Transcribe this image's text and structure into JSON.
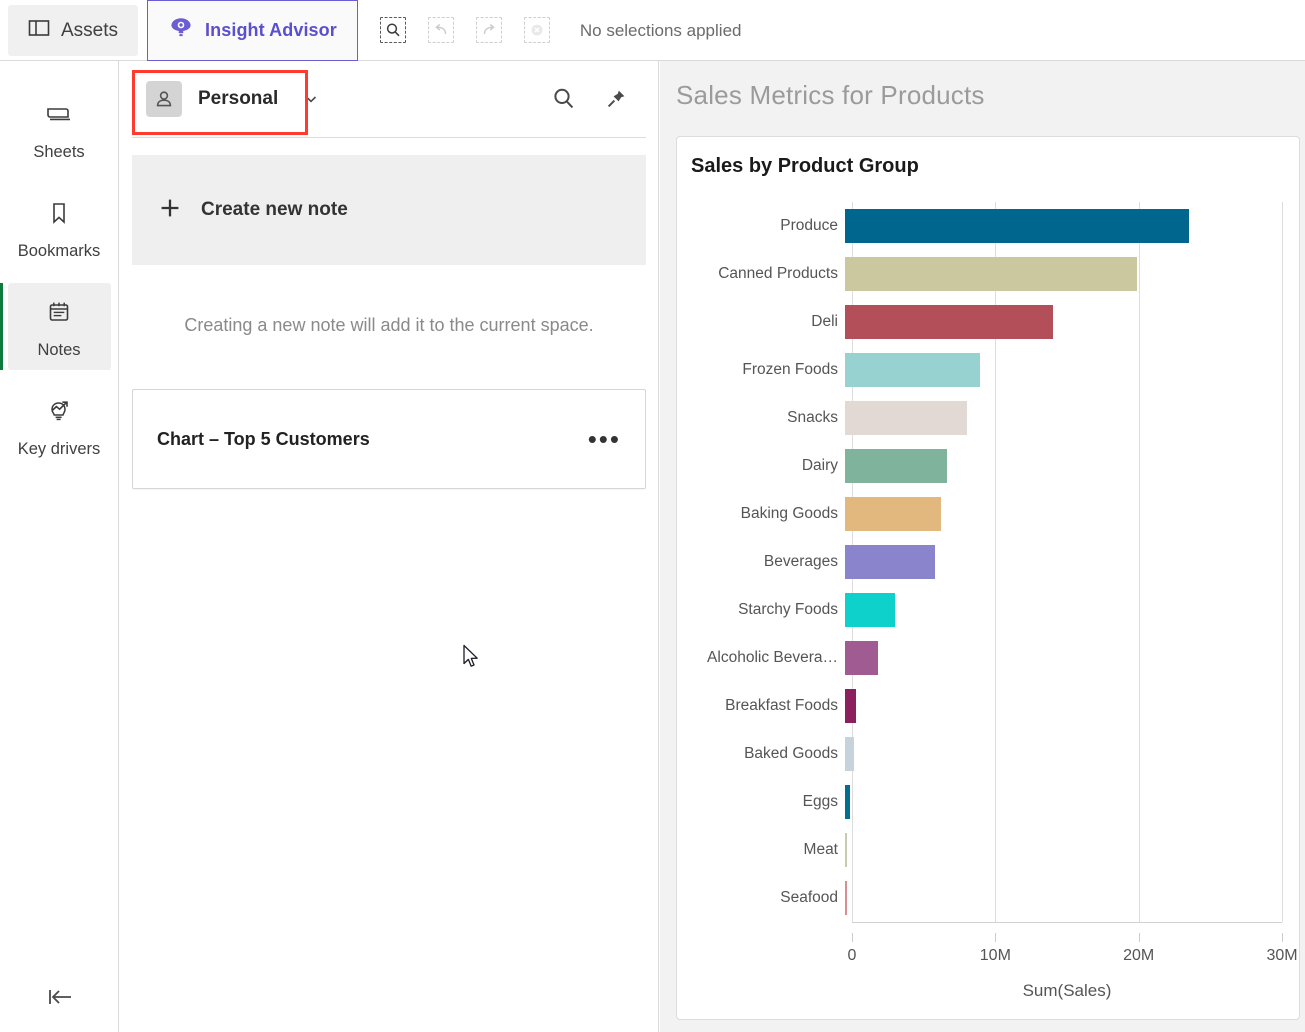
{
  "topbar": {
    "tabs": [
      {
        "id": "assets",
        "label": "Assets",
        "icon": "panel-layout-icon",
        "active": false
      },
      {
        "id": "insight-advisor",
        "label": "Insight Advisor",
        "icon": "lightbulb-eye-icon",
        "active": true
      }
    ],
    "tools": [
      {
        "id": "selection-search",
        "name": "selection-search-icon",
        "disabled": false
      },
      {
        "id": "undo",
        "name": "undo-icon",
        "disabled": true
      },
      {
        "id": "redo",
        "name": "redo-icon",
        "disabled": true
      },
      {
        "id": "clear-selections",
        "name": "clear-selections-icon",
        "disabled": true
      }
    ],
    "selection_status": "No selections applied"
  },
  "rail": {
    "items": [
      {
        "id": "sheets",
        "label": "Sheets",
        "icon": "sheet-icon",
        "active": false
      },
      {
        "id": "bookmarks",
        "label": "Bookmarks",
        "icon": "bookmark-icon",
        "active": false
      },
      {
        "id": "notes",
        "label": "Notes",
        "icon": "notepad-icon",
        "active": true
      },
      {
        "id": "key-drivers",
        "label": "Key drivers",
        "icon": "key-drivers-icon",
        "active": false
      }
    ],
    "collapse_icon": "collapse-left-icon",
    "active_indicator_color": "#0b7b3e"
  },
  "notes": {
    "space": {
      "name": "Personal",
      "avatar_icon": "person-icon",
      "chevron_icon": "chevron-down-icon"
    },
    "header_actions": [
      {
        "id": "search",
        "icon": "search-icon"
      },
      {
        "id": "pin",
        "icon": "pin-icon"
      }
    ],
    "create": {
      "label": "Create new note",
      "icon": "plus-icon"
    },
    "hint": "Creating a new note will add it to the current space.",
    "items": [
      {
        "title": "Chart – Top 5 Customers",
        "menu_icon": "ellipsis-icon",
        "menu_label": "•••"
      }
    ],
    "highlight_color": "#ff3b30"
  },
  "content": {
    "title": "Sales Metrics for Products"
  },
  "chart_data": {
    "type": "bar",
    "orientation": "horizontal",
    "title": "Sales by Product Group",
    "xlabel": "Sum(Sales)",
    "ylabel": "",
    "xlim": [
      0,
      30000000
    ],
    "xticks": [
      0,
      10000000,
      20000000,
      30000000
    ],
    "xticklabels": [
      "0",
      "10M",
      "20M",
      "30M"
    ],
    "grid": true,
    "legend": false,
    "categories": [
      "Produce",
      "Canned Products",
      "Deli",
      "Frozen Foods",
      "Snacks",
      "Dairy",
      "Baking Goods",
      "Beverages",
      "Starchy Foods",
      "Alcoholic Bevera…",
      "Breakfast Foods",
      "Baked Goods",
      "Eggs",
      "Meat",
      "Seafood"
    ],
    "values": [
      24000000,
      20400000,
      14500000,
      9400000,
      8500000,
      7100000,
      6700000,
      6300000,
      3500000,
      2300000,
      760000,
      600000,
      350000,
      150000,
      100000
    ],
    "colors": [
      "#00668e",
      "#cbc8a0",
      "#b24f58",
      "#97d2d0",
      "#e2d9d4",
      "#7fb39b",
      "#e2b87f",
      "#8a84cc",
      "#0fd1cb",
      "#a05b93",
      "#8c1f5e",
      "#c7d3dc",
      "#00708e",
      "#c8cbae",
      "#d98d93"
    ]
  }
}
